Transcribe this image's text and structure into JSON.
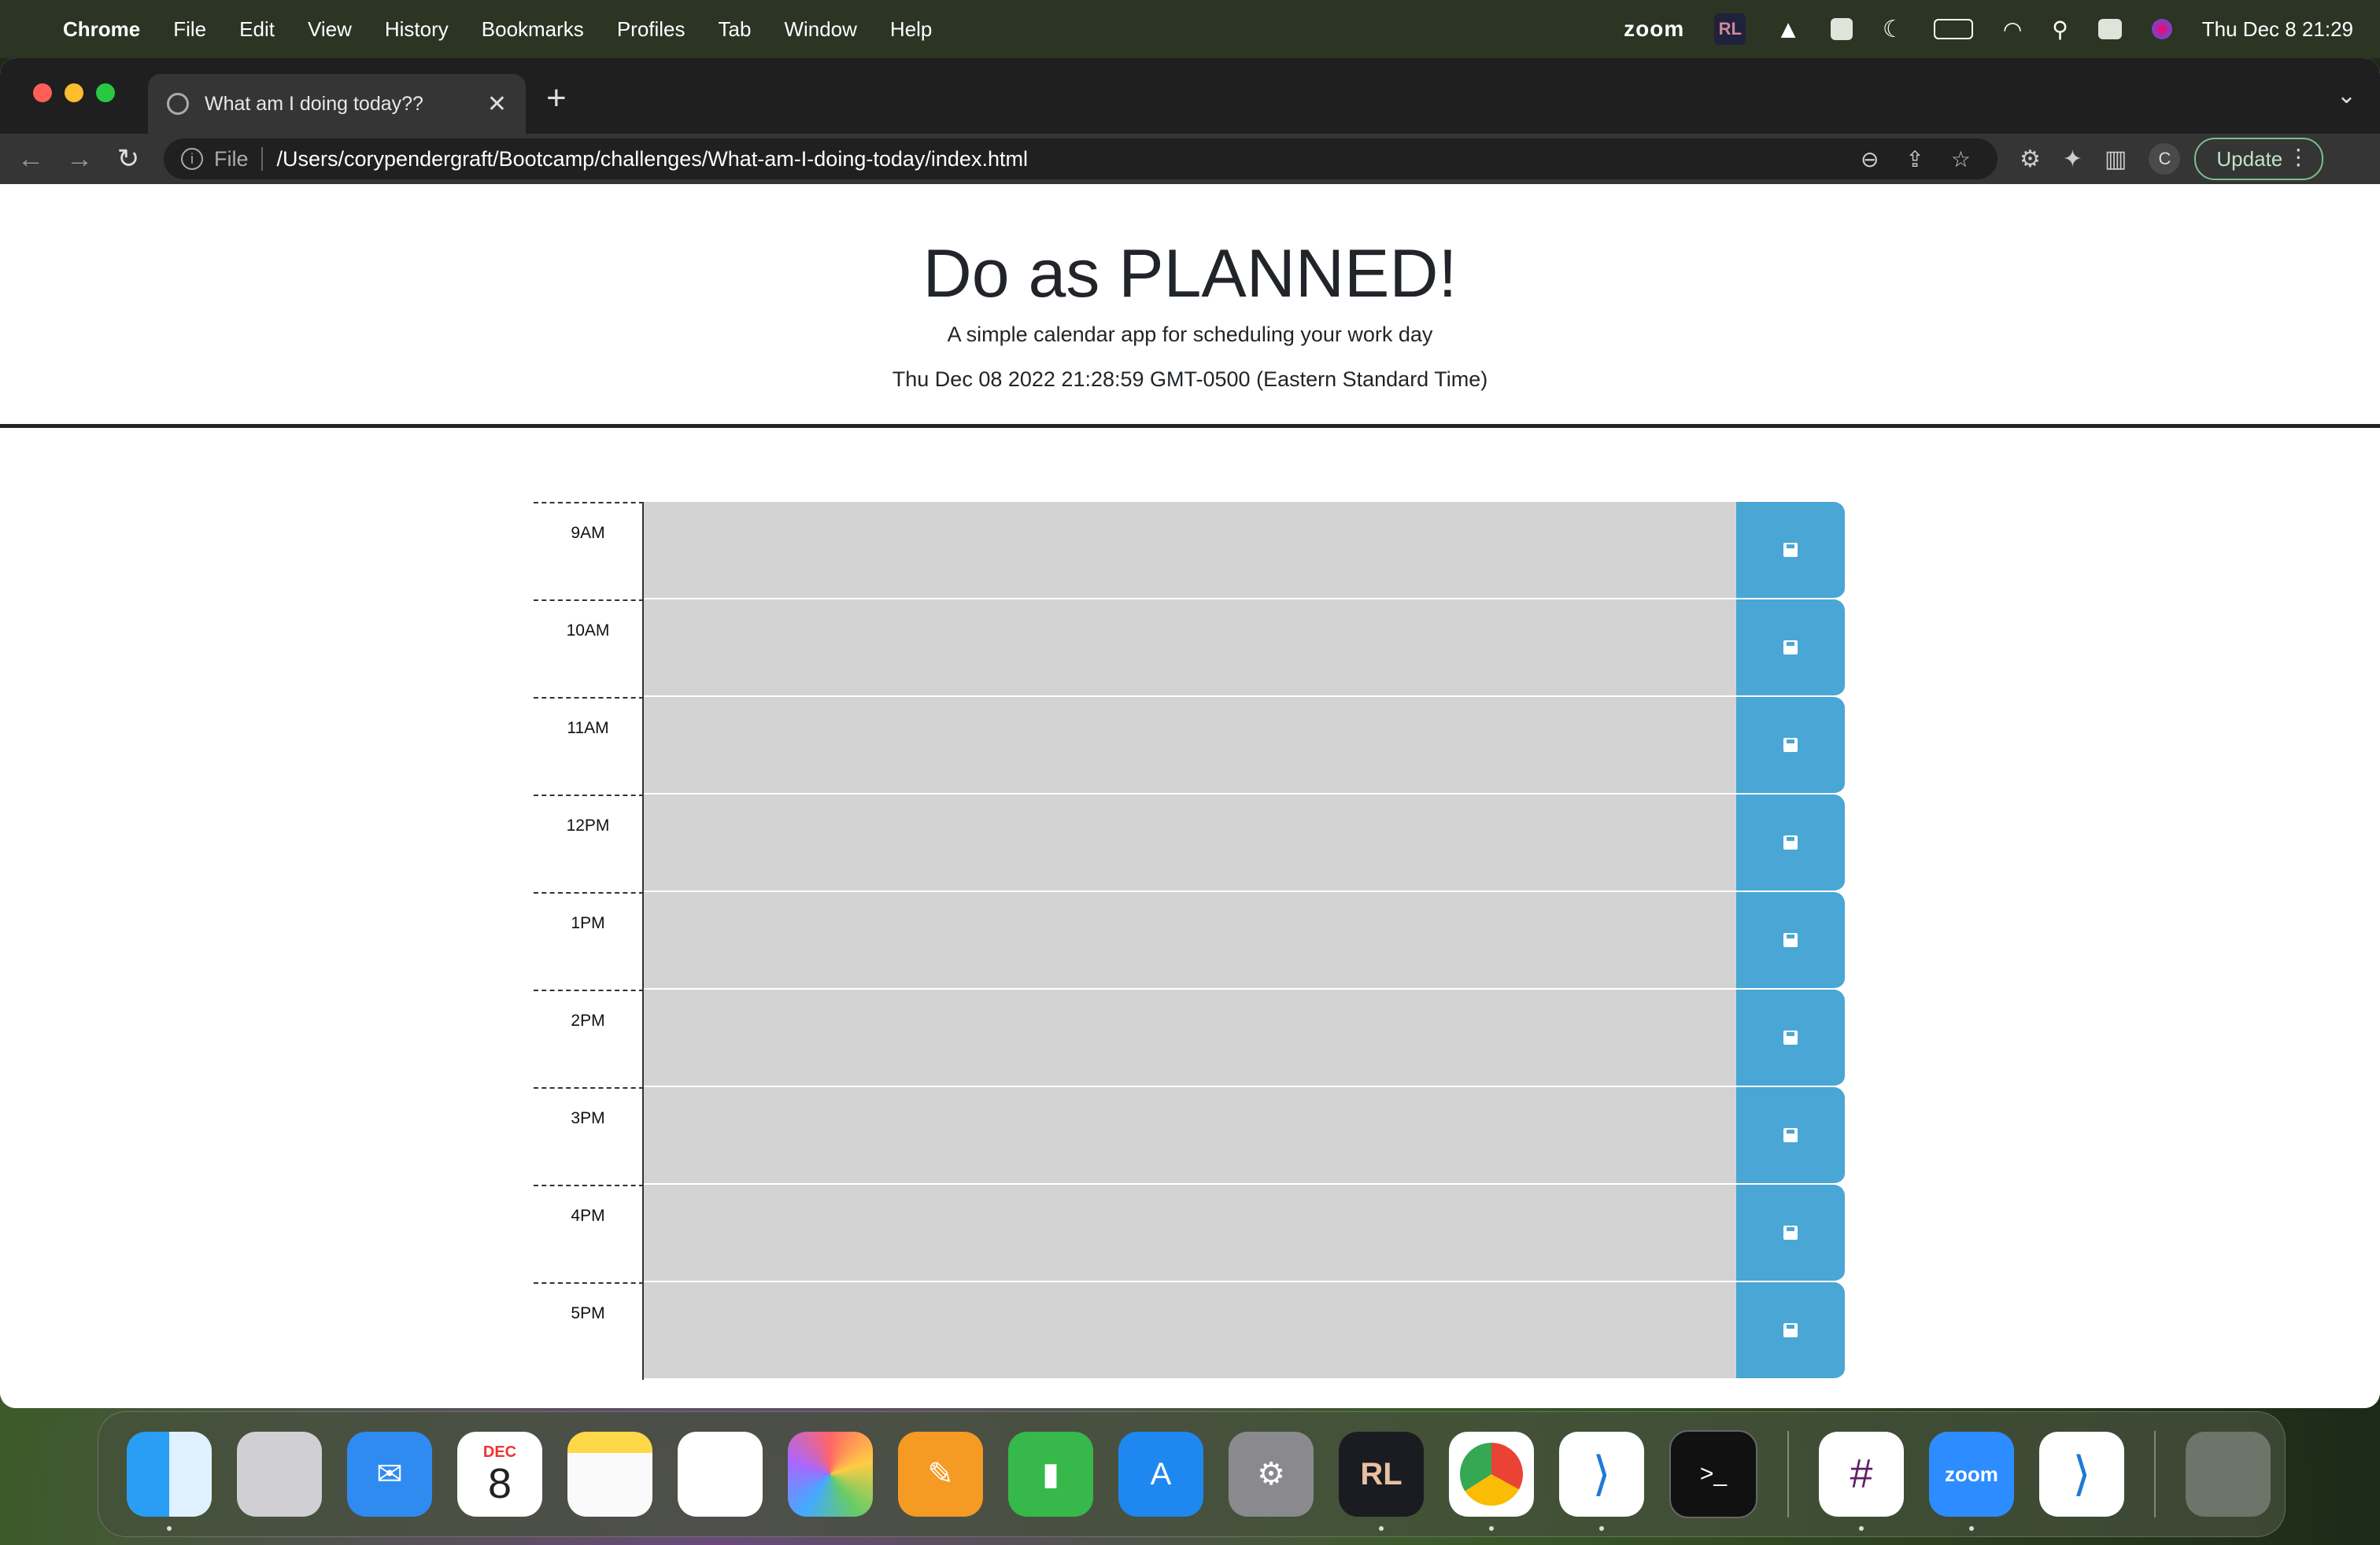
{
  "menubar": {
    "app": "Chrome",
    "items": [
      "File",
      "Edit",
      "View",
      "History",
      "Bookmarks",
      "Profiles",
      "Tab",
      "Window",
      "Help"
    ],
    "zoom": "zoom",
    "rl": "RL",
    "datetime": "Thu Dec 8  21:29"
  },
  "browser": {
    "tab_title": "What am I doing today??",
    "url_scheme": "File",
    "url": "/Users/corypendergraft/Bootcamp/challenges/What-am-I-doing-today/index.html",
    "profile_initial": "C",
    "update_label": "Update"
  },
  "page": {
    "title": "Do as PLANNED!",
    "lead": "A simple calendar app for scheduling your work day",
    "current_date": "Thu Dec 08 2022 21:28:59 GMT-0500 (Eastern Standard Time)",
    "hours": [
      "9AM",
      "10AM",
      "11AM",
      "12PM",
      "1PM",
      "2PM",
      "3PM",
      "4PM",
      "5PM"
    ]
  },
  "dock": {
    "calendar_month": "DEC",
    "calendar_day": "8",
    "rl": "RL",
    "zoom": "zoom",
    "apps": [
      "finder",
      "launchpad",
      "mail",
      "calendar",
      "notes",
      "reminders",
      "photos",
      "pages",
      "numbers",
      "app-store",
      "system-preferences",
      "rl-app",
      "chrome",
      "vscode",
      "terminal",
      "slack",
      "zoom",
      "vscode-2",
      "trash"
    ]
  },
  "colors": {
    "save_button": "#4aa6d4",
    "row_past": "#d3d3d3",
    "browser_dark": "#1f1f1f"
  }
}
